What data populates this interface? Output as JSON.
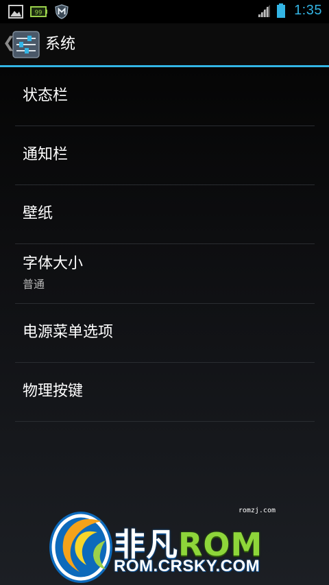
{
  "status_bar": {
    "time": "1:35",
    "battery_badge": "99",
    "left_icons": [
      "image-icon",
      "battery-badge-icon",
      "shield-m-icon"
    ],
    "right_icons": [
      "signal-icon",
      "battery-icon"
    ],
    "accent_color": "#33b5e5"
  },
  "action_bar": {
    "title": "系统",
    "back_icon": "back-chevron-icon",
    "app_icon": "settings-sliders-icon",
    "divider_color": "#33b5e5"
  },
  "list": {
    "items": [
      {
        "title": "状态栏"
      },
      {
        "title": "通知栏"
      },
      {
        "title": "壁纸"
      },
      {
        "title": "字体大小",
        "summary": "普通"
      },
      {
        "title": "电源菜单选项"
      },
      {
        "title": "物理按键"
      }
    ]
  },
  "watermark": {
    "small_text": "romzj.com",
    "brand_cn": "非凡",
    "brand_rom": "ROM",
    "url": "ROM.CRSKY.COM",
    "logo_icon": "crsky-swirl-logo-icon"
  }
}
